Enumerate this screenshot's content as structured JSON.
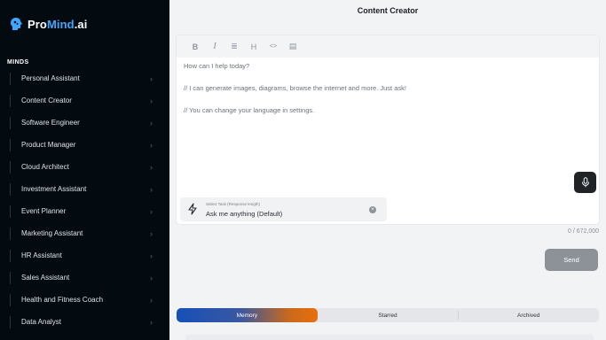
{
  "app": {
    "logo_prefix": "Pro",
    "logo_accent": "Mind",
    "logo_suffix": ".ai",
    "brand_color": "#3ea7ff"
  },
  "sidebar": {
    "section_label": "MINDS",
    "items": [
      {
        "label": "Personal Assistant"
      },
      {
        "label": "Content Creator"
      },
      {
        "label": "Software Engineer"
      },
      {
        "label": "Product Manager"
      },
      {
        "label": "Cloud Architect"
      },
      {
        "label": "Investment Assistant"
      },
      {
        "label": "Event Planner"
      },
      {
        "label": "Marketing Assistant"
      },
      {
        "label": "HR Assistant"
      },
      {
        "label": "Sales Assistant"
      },
      {
        "label": "Health and Fitness Coach"
      },
      {
        "label": "Data Analyst"
      }
    ]
  },
  "header": {
    "title": "Content Creator"
  },
  "editor": {
    "toolbar": [
      {
        "name": "bold",
        "glyph": "B"
      },
      {
        "name": "italic",
        "glyph": "I"
      },
      {
        "name": "align",
        "glyph": "≣"
      },
      {
        "name": "heading",
        "glyph": "H"
      },
      {
        "name": "code",
        "glyph": "<>"
      },
      {
        "name": "table",
        "glyph": "▤"
      }
    ],
    "lines": [
      "How can I help today?",
      "// I can generate images, diagrams, browse the internet and more. Just ask!",
      "// You can change your language in settings."
    ]
  },
  "task_select": {
    "caption": "Select Task (Response length)",
    "value": "Ask me anything (Default)"
  },
  "composer": {
    "char_count": "0 / 672,000",
    "send_label": "Send"
  },
  "tabs": [
    {
      "label": "Memory",
      "active": true
    },
    {
      "label": "Starred",
      "active": false
    },
    {
      "label": "Archived",
      "active": false
    }
  ]
}
